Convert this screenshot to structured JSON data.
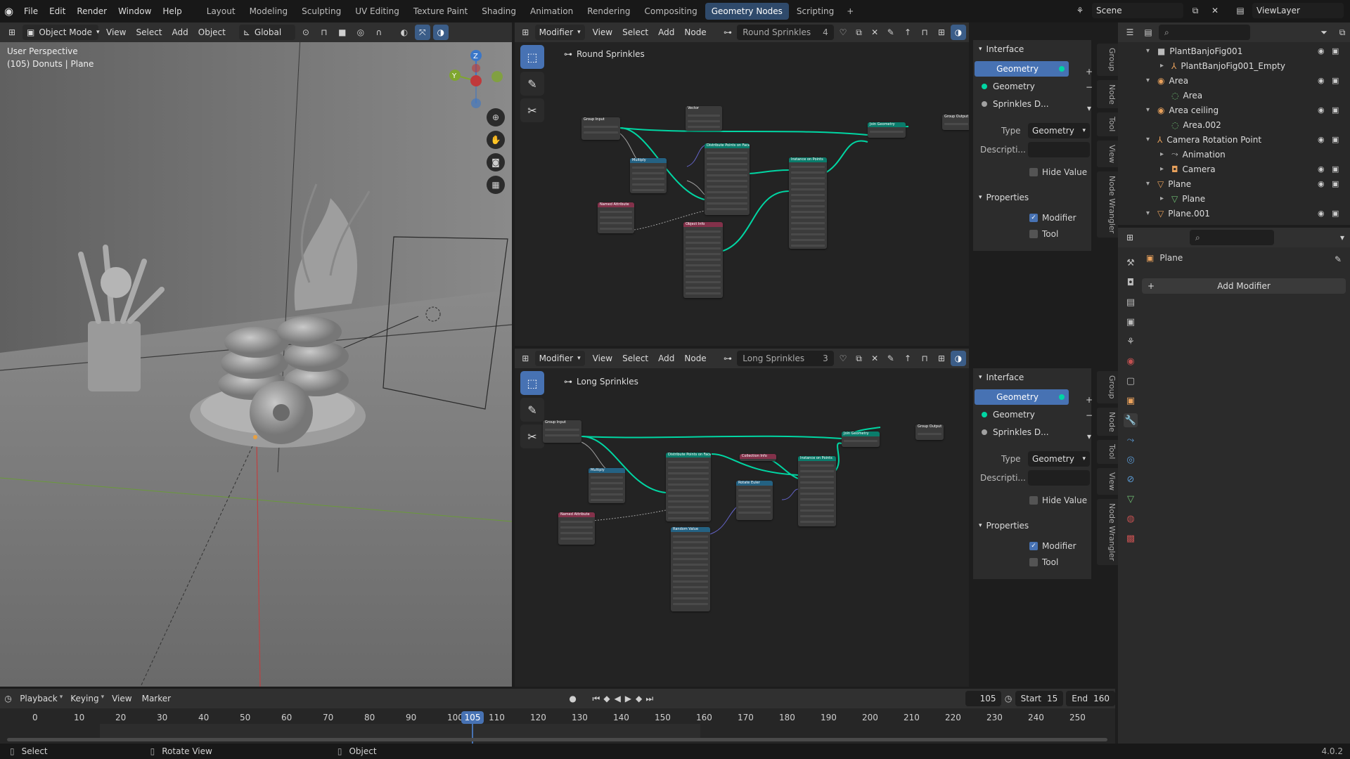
{
  "menubar": {
    "items": [
      "File",
      "Edit",
      "Render",
      "Window",
      "Help"
    ],
    "workspaces": [
      "Layout",
      "Modeling",
      "Sculpting",
      "UV Editing",
      "Texture Paint",
      "Shading",
      "Animation",
      "Rendering",
      "Compositing",
      "Geometry Nodes",
      "Scripting"
    ],
    "active_workspace": "Geometry Nodes",
    "add_tab": "+",
    "scene": "Scene",
    "view_layer": "ViewLayer"
  },
  "viewport": {
    "mode": "Object Mode",
    "menus": [
      "View",
      "Select",
      "Add",
      "Object"
    ],
    "transform": "Global",
    "overlay_title": "User Perspective",
    "overlay_sub": "(105) Donuts | Plane",
    "gizmo": {
      "z": "Z",
      "y": "Y"
    }
  },
  "node_top": {
    "editor_mode": "Modifier",
    "menus": [
      "View",
      "Select",
      "Add",
      "Node"
    ],
    "tree_name": "Round Sprinkles",
    "users": "4",
    "breadcrumb": "Round Sprinkles"
  },
  "node_bottom": {
    "editor_mode": "Modifier",
    "menus": [
      "View",
      "Select",
      "Add",
      "Node"
    ],
    "tree_name": "Long Sprinkles",
    "users": "3",
    "breadcrumb": "Long Sprinkles"
  },
  "nodes_top": [
    {
      "title": "Group Input",
      "color": "#3b3b3b"
    },
    {
      "title": "Vector",
      "color": "#3b3b3b"
    },
    {
      "title": "Multiply",
      "color": "#246283"
    },
    {
      "title": "Named Attribute",
      "color": "#83314a"
    },
    {
      "title": "Distribute Points on Faces",
      "color": "#0a7c6b"
    },
    {
      "title": "Object Info",
      "color": "#83314a"
    },
    {
      "title": "Instance on Points",
      "color": "#0a7c6b"
    },
    {
      "title": "Join Geometry",
      "color": "#0a7c6b"
    },
    {
      "title": "Group Output",
      "color": "#3b3b3b"
    }
  ],
  "nodes_bottom": [
    {
      "title": "Group Input",
      "color": "#3b3b3b"
    },
    {
      "title": "Multiply",
      "color": "#246283"
    },
    {
      "title": "Named Attribute",
      "color": "#83314a"
    },
    {
      "title": "Distribute Points on Faces",
      "color": "#0a7c6b"
    },
    {
      "title": "Random Value",
      "color": "#246283"
    },
    {
      "title": "Collection Info",
      "color": "#83314a"
    },
    {
      "title": "Rotate Euler",
      "color": "#246283"
    },
    {
      "title": "Instance on Points",
      "color": "#0a7c6b"
    },
    {
      "title": "Join Geometry",
      "color": "#0a7c6b"
    },
    {
      "title": "Group Output",
      "color": "#3b3b3b"
    }
  ],
  "interface_panel": {
    "title": "Interface",
    "items": [
      {
        "label": "Geometry",
        "dot": "#00d6a3",
        "selected": true
      },
      {
        "label": "Geometry",
        "dot": "#00d6a3",
        "selected": false
      },
      {
        "label": "Sprinkles D...",
        "dot": "#a1a1a1",
        "selected": false
      }
    ],
    "type_label": "Type",
    "type_value": "Geometry",
    "desc_label": "Descripti...",
    "hide_value": "Hide Value",
    "properties_title": "Properties",
    "modifier": "Modifier",
    "tool": "Tool"
  },
  "side_tabs": [
    "Group",
    "Node",
    "Tool",
    "View",
    "Node Wrangler"
  ],
  "outliner": {
    "rows": [
      {
        "label": "PlantBanjoFig001",
        "indent": 0,
        "exp": "▾",
        "color": "#bbbbbb",
        "icon": "■"
      },
      {
        "label": "PlantBanjoFig001_Empty",
        "indent": 1,
        "exp": "▸",
        "color": "#e8a15c",
        "icon": "⅄"
      },
      {
        "label": "Area",
        "indent": 0,
        "exp": "▾",
        "color": "#e8a15c",
        "icon": "◉"
      },
      {
        "label": "Area",
        "indent": 1,
        "exp": "",
        "color": "#6fbf73",
        "icon": "◌"
      },
      {
        "label": "Area ceiling",
        "indent": 0,
        "exp": "▾",
        "color": "#e8a15c",
        "icon": "◉"
      },
      {
        "label": "Area.002",
        "indent": 1,
        "exp": "",
        "color": "#6fbf73",
        "icon": "◌"
      },
      {
        "label": "Camera Rotation Point",
        "indent": 0,
        "exp": "▾",
        "color": "#e8a15c",
        "icon": "⅄"
      },
      {
        "label": "Animation",
        "indent": 1,
        "exp": "▸",
        "color": "#bbbbbb",
        "icon": "⤳"
      },
      {
        "label": "Camera",
        "indent": 1,
        "exp": "▸",
        "color": "#e8a15c",
        "icon": "◘"
      },
      {
        "label": "Plane",
        "indent": 0,
        "exp": "▾",
        "color": "#e8a15c",
        "icon": "▽"
      },
      {
        "label": "Plane",
        "indent": 1,
        "exp": "▸",
        "color": "#6fbf73",
        "icon": "▽"
      },
      {
        "label": "Plane.001",
        "indent": 0,
        "exp": "▾",
        "color": "#e8a15c",
        "icon": "▽"
      }
    ]
  },
  "properties": {
    "object_name": "Plane",
    "add_modifier": "Add Modifier"
  },
  "timeline": {
    "menus": [
      "Playback",
      "Keying",
      "View",
      "Marker"
    ],
    "current_frame": "105",
    "start_label": "Start",
    "start": "15",
    "end_label": "End",
    "end": "160",
    "ticks": [
      "0",
      "10",
      "20",
      "30",
      "40",
      "50",
      "60",
      "70",
      "80",
      "90",
      "100",
      "110",
      "120",
      "130",
      "140",
      "150",
      "160",
      "170",
      "180",
      "190",
      "200",
      "210",
      "220",
      "230",
      "240",
      "250"
    ]
  },
  "statusbar": {
    "select": "Select",
    "rotate": "Rotate View",
    "object": "Object",
    "version": "4.0.2"
  }
}
